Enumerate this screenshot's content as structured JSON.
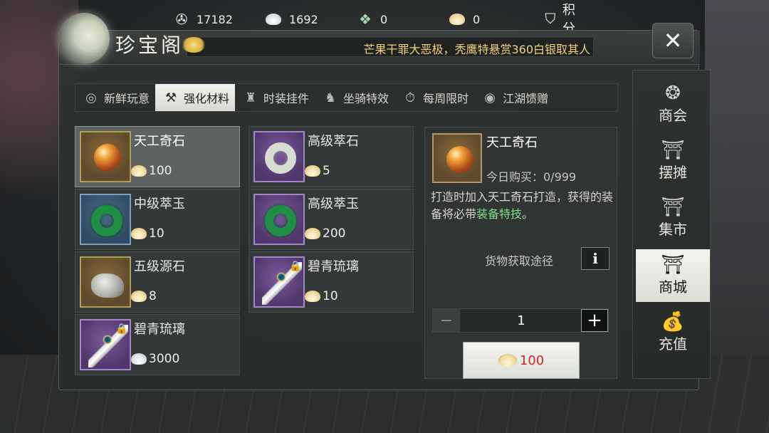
{
  "currencies": [
    {
      "icon": "film-reel-icon",
      "value": "17182"
    },
    {
      "icon": "silver-ingot-icon",
      "value": "1692"
    },
    {
      "icon": "jade-ticket-icon",
      "value": "0"
    },
    {
      "icon": "gold-ingot-plus-icon",
      "value": "0"
    },
    {
      "icon": "points-shield-icon",
      "value": "积分"
    }
  ],
  "window": {
    "title": "珍宝阁",
    "marquee": "芒果干罪大恶极，秃鹰特悬赏360白银取其人"
  },
  "tabs": [
    {
      "label": "新鲜玩意",
      "icon": "lantern-icon",
      "active": false
    },
    {
      "label": "强化材料",
      "icon": "hammer-icon",
      "active": true
    },
    {
      "label": "时装挂件",
      "icon": "robe-icon",
      "active": false
    },
    {
      "label": "坐骑特效",
      "icon": "horse-icon",
      "active": false
    },
    {
      "label": "每周限时",
      "icon": "stopwatch-icon",
      "active": false
    },
    {
      "label": "江湖馈赠",
      "icon": "gift-coin-icon",
      "active": false
    }
  ],
  "items": [
    {
      "name": "天工奇石",
      "price": "100",
      "currency": "gold",
      "art": "orange-gem",
      "selected": true
    },
    {
      "name": "高级萃石",
      "price": "5",
      "currency": "gold",
      "art": "white-jade-ring",
      "selected": false
    },
    {
      "name": "中级萃玉",
      "price": "10",
      "currency": "gold",
      "art": "green-jade-ring",
      "selected": false
    },
    {
      "name": "高级萃玉",
      "price": "200",
      "currency": "gold",
      "art": "green-jade-ring",
      "selected": false
    },
    {
      "name": "五级源石",
      "price": "8",
      "currency": "gold",
      "art": "rock",
      "selected": false
    },
    {
      "name": "碧青琉璃",
      "price": "10",
      "currency": "gold",
      "art": "peacock-feather",
      "selected": false,
      "locked": true
    },
    {
      "name": "碧青琉璃",
      "price": "3000",
      "currency": "silver",
      "art": "peacock-feather",
      "selected": false,
      "locked": true
    }
  ],
  "detail": {
    "name": "天工奇石",
    "daily_limit": "今日购买：0/999",
    "desc_prefix": "打造时加入天工奇石打造，获得的装备将必带",
    "desc_highlight": "装备特技",
    "desc_suffix": "。",
    "source_label": "货物获取途径",
    "info_label": "i",
    "quantity": "1",
    "minus_label": "−",
    "plus_label": "+",
    "buy_price": "100"
  },
  "side_nav": [
    {
      "label": "商会",
      "icon": "guild-emblem-icon",
      "active": false
    },
    {
      "label": "摆摊",
      "icon": "stall-icon",
      "active": false
    },
    {
      "label": "集市",
      "icon": "market-icon",
      "active": false
    },
    {
      "label": "商城",
      "icon": "pavilion-icon",
      "active": true
    },
    {
      "label": "充值",
      "icon": "money-bag-icon",
      "active": false
    }
  ],
  "colors": {
    "accent_highlight": "#7fe08a",
    "price_red": "#d0262a",
    "marquee_gold": "#f1d27a"
  }
}
